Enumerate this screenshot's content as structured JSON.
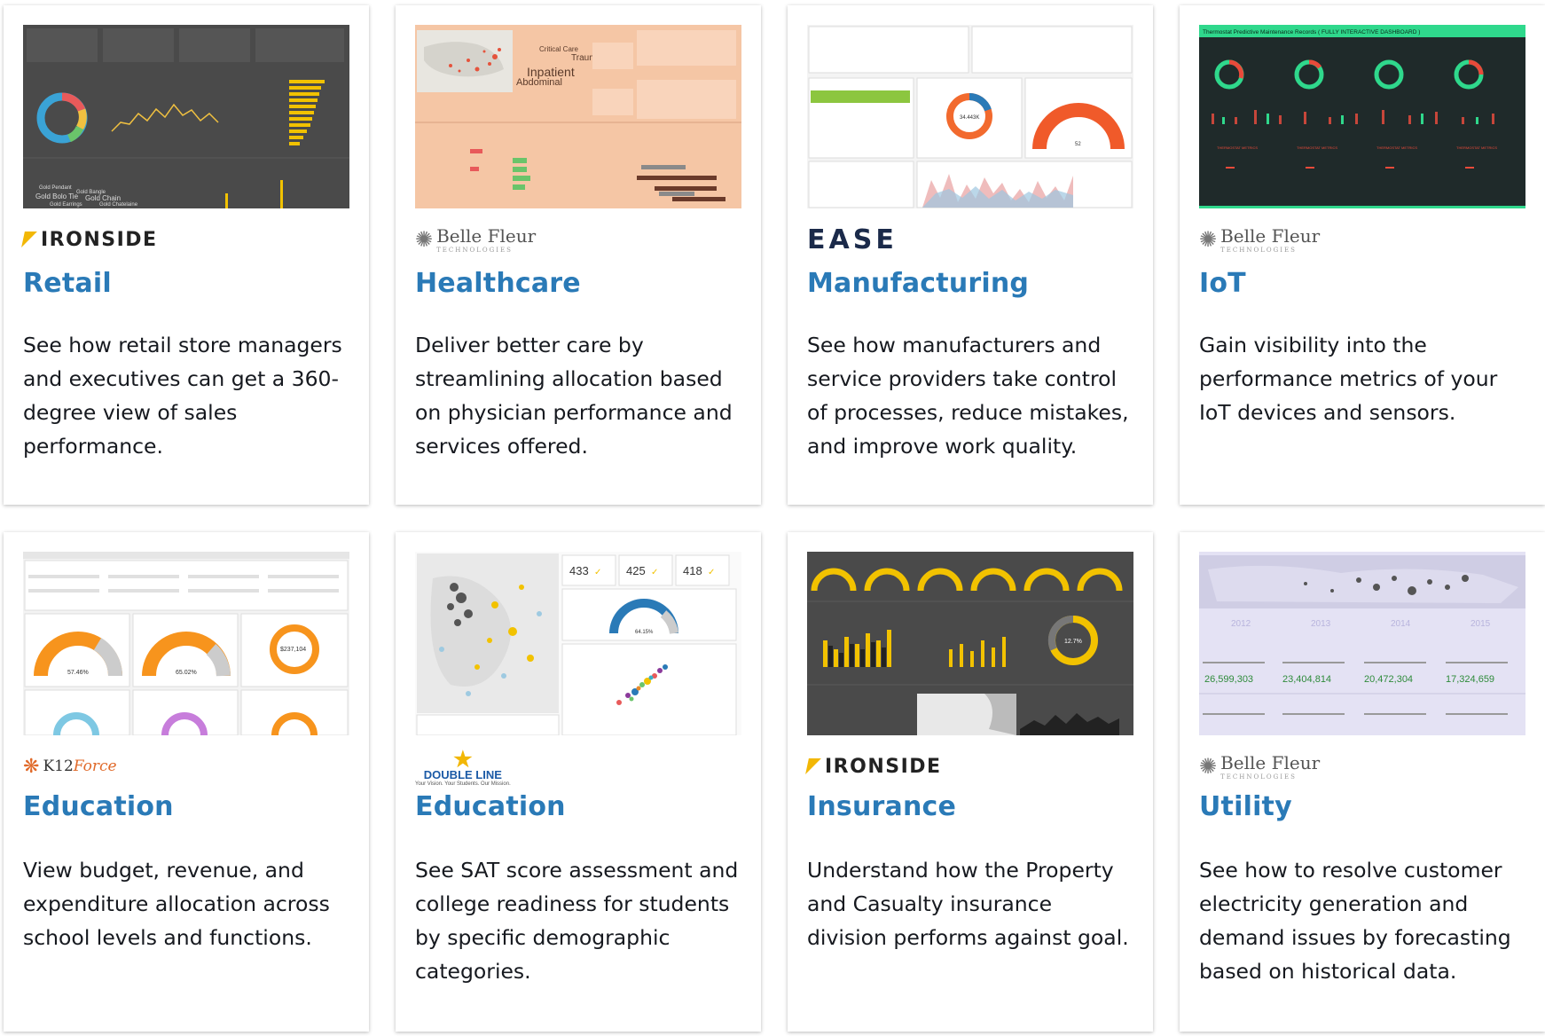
{
  "cards": [
    {
      "logo": "IRONSIDE",
      "title": "Retail",
      "desc": "See how retail store managers and executives can get a 360-degree view of sales performance."
    },
    {
      "logo": "Belle Fleur",
      "logo_sub": "TECHNOLOGIES",
      "title": "Healthcare",
      "desc": "Deliver better care by streamlining allocation based on physician performance and services offered."
    },
    {
      "logo": "EASE",
      "title": "Manufacturing",
      "desc": "See how manufacturers and service providers take control of processes, reduce mistakes, and improve work quality."
    },
    {
      "logo": "Belle Fleur",
      "logo_sub": "TECHNOLOGIES",
      "title": "IoT",
      "desc": "Gain visibility into the performance metrics of your IoT devices and sensors."
    },
    {
      "logo_a": "K12",
      "logo_b": "Force",
      "title": "Education",
      "desc": "View budget, revenue, and expenditure allocation across school levels and functions."
    },
    {
      "logo": "DOUBLE LINE",
      "logo_sub": "Your Vision. Your Students. Our Mission.",
      "title": "Education",
      "desc": "See SAT score assessment and college readiness for students by specific demographic categories."
    },
    {
      "logo": "IRONSIDE",
      "title": "Insurance",
      "desc": "Understand how the Property and Casualty insurance division performs against goal."
    },
    {
      "logo": "Belle Fleur",
      "logo_sub": "TECHNOLOGIES",
      "title": "Utility",
      "desc": "See how to resolve customer electricity generation and demand issues by forecasting based on historical data."
    }
  ],
  "thumbs": {
    "healthcare_words": [
      "Inpatient",
      "Abdominal",
      "Trauma",
      "Critical Care"
    ],
    "iot_title": "Thermostat Predictive Maintenance Records ( FULLY INTERACTIVE DASHBOARD )",
    "mfg_gauge": "52",
    "mfg_donut": "34.443K",
    "edu_gauges": [
      "57.46%",
      "65.02%",
      "$237,104"
    ],
    "sat_counts": [
      "433",
      "425",
      "418"
    ],
    "sat_gauge": "64.15%",
    "ins_gauge": "12.7%",
    "util_years": [
      "2012",
      "2013",
      "2014",
      "2015"
    ],
    "util_values": [
      "26,599,303",
      "23,404,814",
      "20,472,304",
      "17,324,659"
    ]
  },
  "colors": {
    "title": "#2a7ab7",
    "text": "#16191f",
    "ironside_accent": "#f2b705"
  }
}
